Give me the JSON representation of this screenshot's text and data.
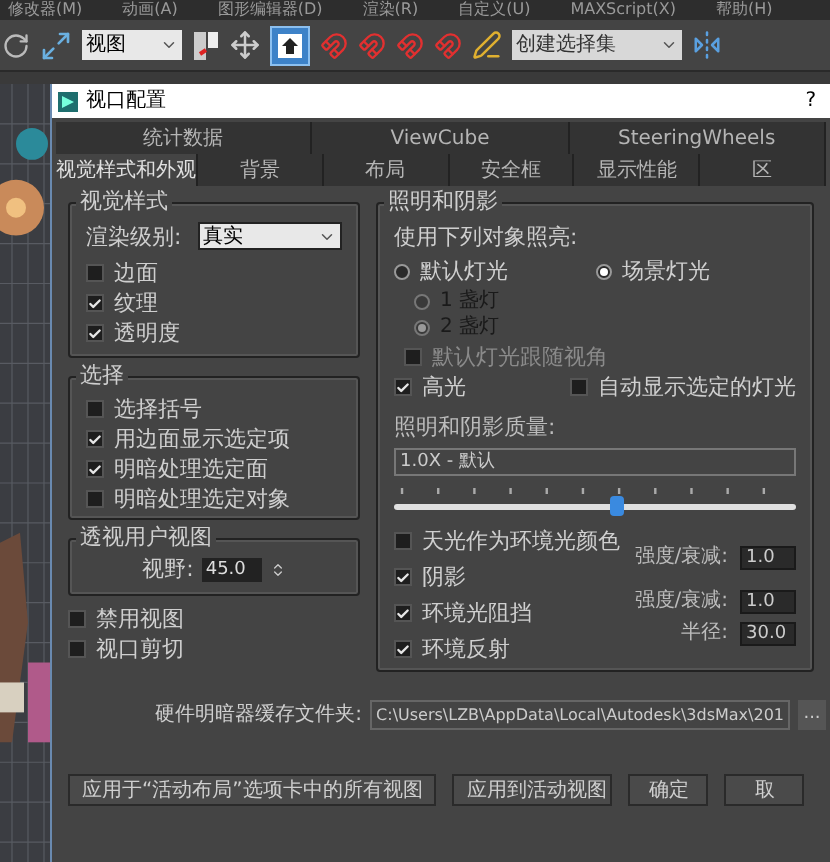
{
  "menu": [
    "修改器(M)",
    "动画(A)",
    "图形编辑器(D)",
    "渲染(R)",
    "自定义(U)",
    "MAXScript(X)",
    "帮助(H)"
  ],
  "toolbar": {
    "view_dropdown": "视图",
    "selection_set": "创建选择集"
  },
  "dialog": {
    "title": "视口配置",
    "help": "?",
    "tabs_row1": [
      {
        "label": "统计数据",
        "selected": false
      },
      {
        "label": "ViewCube",
        "selected": false
      },
      {
        "label": "SteeringWheels",
        "selected": false
      }
    ],
    "tabs_row2": [
      {
        "label": "视觉样式和外观",
        "selected": true
      },
      {
        "label": "背景",
        "selected": false
      },
      {
        "label": "布局",
        "selected": false
      },
      {
        "label": "安全框",
        "selected": false
      },
      {
        "label": "显示性能",
        "selected": false
      },
      {
        "label": "区",
        "selected": false
      }
    ],
    "visual_style": {
      "title": "视觉样式",
      "render_level_label": "渲染级别:",
      "render_level": "真实",
      "options": [
        {
          "label": "边面",
          "checked": false
        },
        {
          "label": "纹理",
          "checked": true
        },
        {
          "label": "透明度",
          "checked": true
        }
      ]
    },
    "selection": {
      "title": "选择",
      "options": [
        {
          "label": "选择括号",
          "checked": false
        },
        {
          "label": "用边面显示选定项",
          "checked": true
        },
        {
          "label": "明暗处理选定面",
          "checked": true
        },
        {
          "label": "明暗处理选定对象",
          "checked": false
        }
      ]
    },
    "perspective": {
      "title": "透视用户视图",
      "fov_label": "视野:",
      "fov": "45.0"
    },
    "extra_options": [
      {
        "label": "禁用视图",
        "checked": false
      },
      {
        "label": "视口剪切",
        "checked": false
      }
    ],
    "lighting": {
      "title": "照明和阴影",
      "illuminate_label": "使用下列对象照亮:",
      "sources": [
        {
          "label": "默认灯光",
          "selected": false
        },
        {
          "label": "场景灯光",
          "selected": true
        }
      ],
      "lamp_counts": [
        {
          "label": "1 盏灯",
          "selected": false,
          "disabled": true
        },
        {
          "label": "2 盏灯",
          "selected": true,
          "disabled": true
        }
      ],
      "follow_view": {
        "label": "默认灯光跟随视角",
        "checked": false,
        "disabled": true
      },
      "highlight": {
        "label": "高光",
        "checked": true
      },
      "auto_show": {
        "label": "自动显示选定的灯光",
        "checked": false
      },
      "quality_label": "照明和阴影质量:",
      "quality": "1.0X - 默认",
      "quality_slider": {
        "level": 0.55
      },
      "effects": [
        {
          "label": "天光作为环境光颜色",
          "checked": false
        },
        {
          "label": "阴影",
          "checked": true
        },
        {
          "label": "环境光阻挡",
          "checked": true
        },
        {
          "label": "环境反射",
          "checked": true
        }
      ],
      "params": [
        {
          "label": "强度/衰减:",
          "value": "1.0"
        },
        {
          "label": "强度/衰减:",
          "value": "1.0"
        },
        {
          "label": "半径:",
          "value": "30.0"
        }
      ]
    },
    "cache": {
      "label": "硬件明暗器缓存文件夹:",
      "path": "C:\\Users\\LZB\\AppData\\Local\\Autodesk\\3dsMax\\201",
      "browse": "..."
    },
    "buttons": [
      "应用于“活动布局”选项卡中的所有视图",
      "应用到活动视图",
      "确定",
      "取"
    ]
  }
}
